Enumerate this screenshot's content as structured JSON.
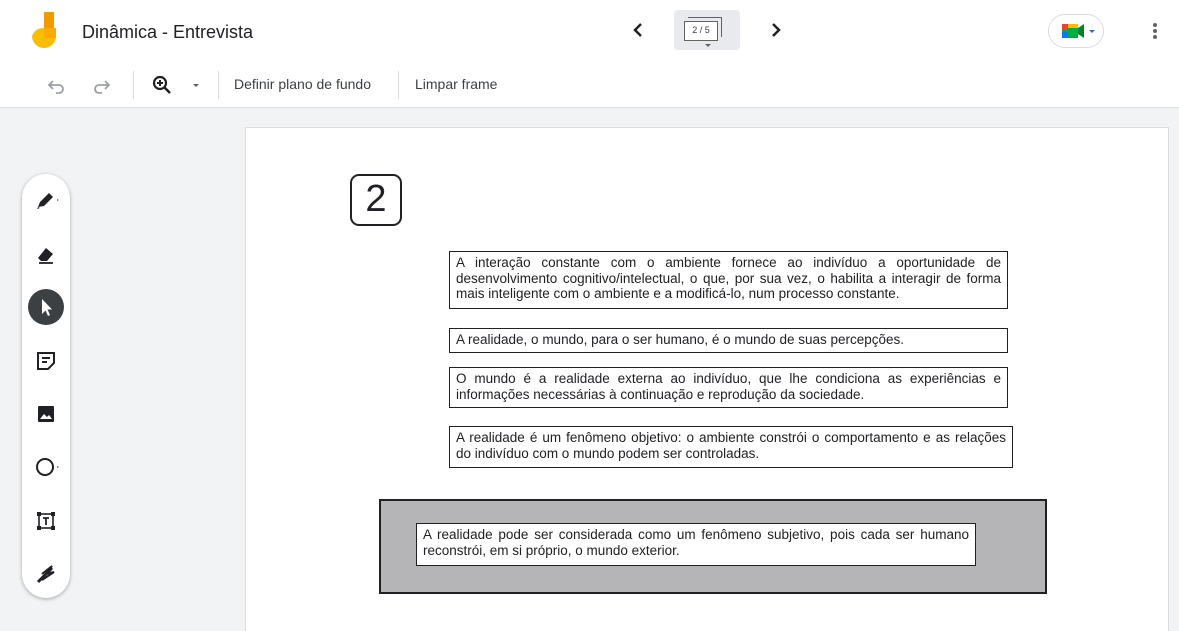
{
  "app": {
    "title": "Dinâmica - Entrevista",
    "frame_indicator": "2 / 5"
  },
  "toolbar": {
    "set_background": "Definir plano de fundo",
    "clear_frame": "Limpar frame"
  },
  "palette": {
    "tools": [
      "pen",
      "eraser",
      "select",
      "sticky-note",
      "image",
      "circle",
      "text-box",
      "laser"
    ],
    "active_tool": "select"
  },
  "canvas": {
    "frame_number": "2",
    "cards": [
      "A interação constante com o ambiente fornece ao indivíduo a oportunidade de desenvolvimento cognitivo/intelectual, o que, por sua vez, o habilita a interagir de forma mais inteligente com o ambiente e a modificá-lo, num processo constante.",
      "A realidade, o mundo, para o ser humano, é o mundo de suas percepções.",
      "O mundo é a realidade externa ao indivíduo, que lhe condiciona as experiências e informações necessárias à continuação e reprodução da sociedade.",
      "A realidade é um fenômeno objetivo: o ambiente constrói o comportamento e as relações do indivíduo com o mundo podem ser controladas."
    ],
    "panel_card": "A realidade pode ser considerada como um fenômeno subjetivo, pois cada ser humano reconstrói, em si próprio, o mundo exterior."
  },
  "colors": {
    "header_bg": "#ffffff",
    "workspace_bg": "#f1f3f4",
    "panel_gray": "#b5b5b7",
    "active_tool": "#3c4043",
    "logo_orange": "#f9ab00",
    "logo_yellow": "#fbbc04"
  }
}
